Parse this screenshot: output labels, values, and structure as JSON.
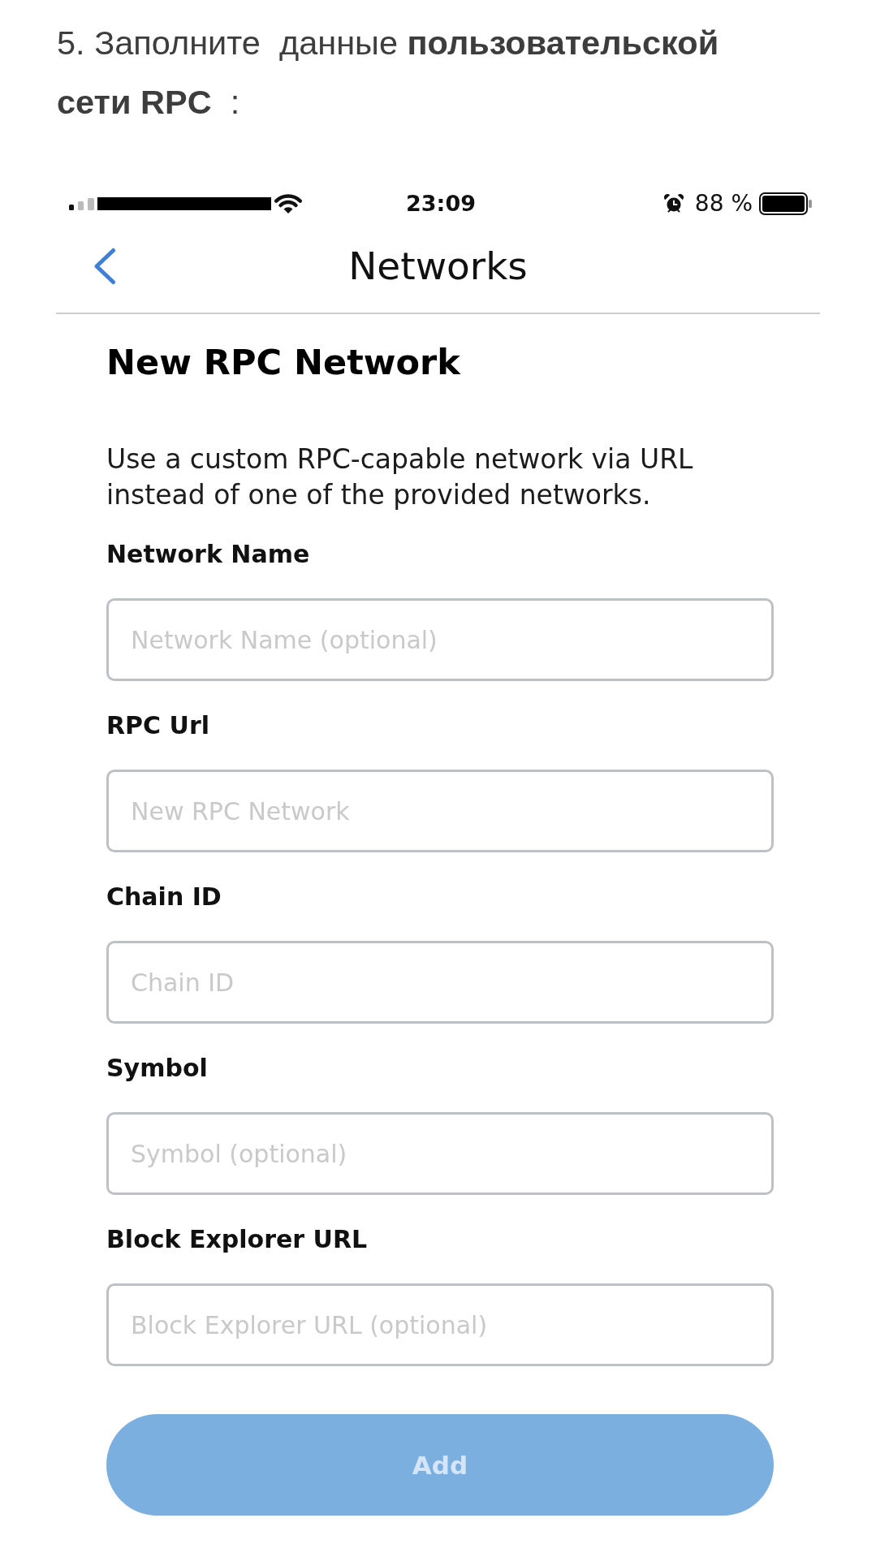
{
  "instruction": {
    "text": "5. Заполните  данные **пользовательской сети RPC**  :"
  },
  "status_bar": {
    "time": "23:09",
    "battery": "88 %"
  },
  "header": {
    "title": "Networks"
  },
  "form": {
    "title": "New RPC Network",
    "description": "Use a custom RPC-capable network via URL instead of one of the provided networks.",
    "fields": [
      {
        "label": "Network Name",
        "placeholder": "Network Name (optional)"
      },
      {
        "label": "RPC Url",
        "placeholder": "New RPC Network"
      },
      {
        "label": "Chain ID",
        "placeholder": "Chain ID"
      },
      {
        "label": "Symbol",
        "placeholder": "Symbol (optional)"
      },
      {
        "label": "Block Explorer URL",
        "placeholder": "Block Explorer URL (optional)"
      }
    ],
    "button": {
      "label": "Add",
      "disabled": true
    }
  }
}
